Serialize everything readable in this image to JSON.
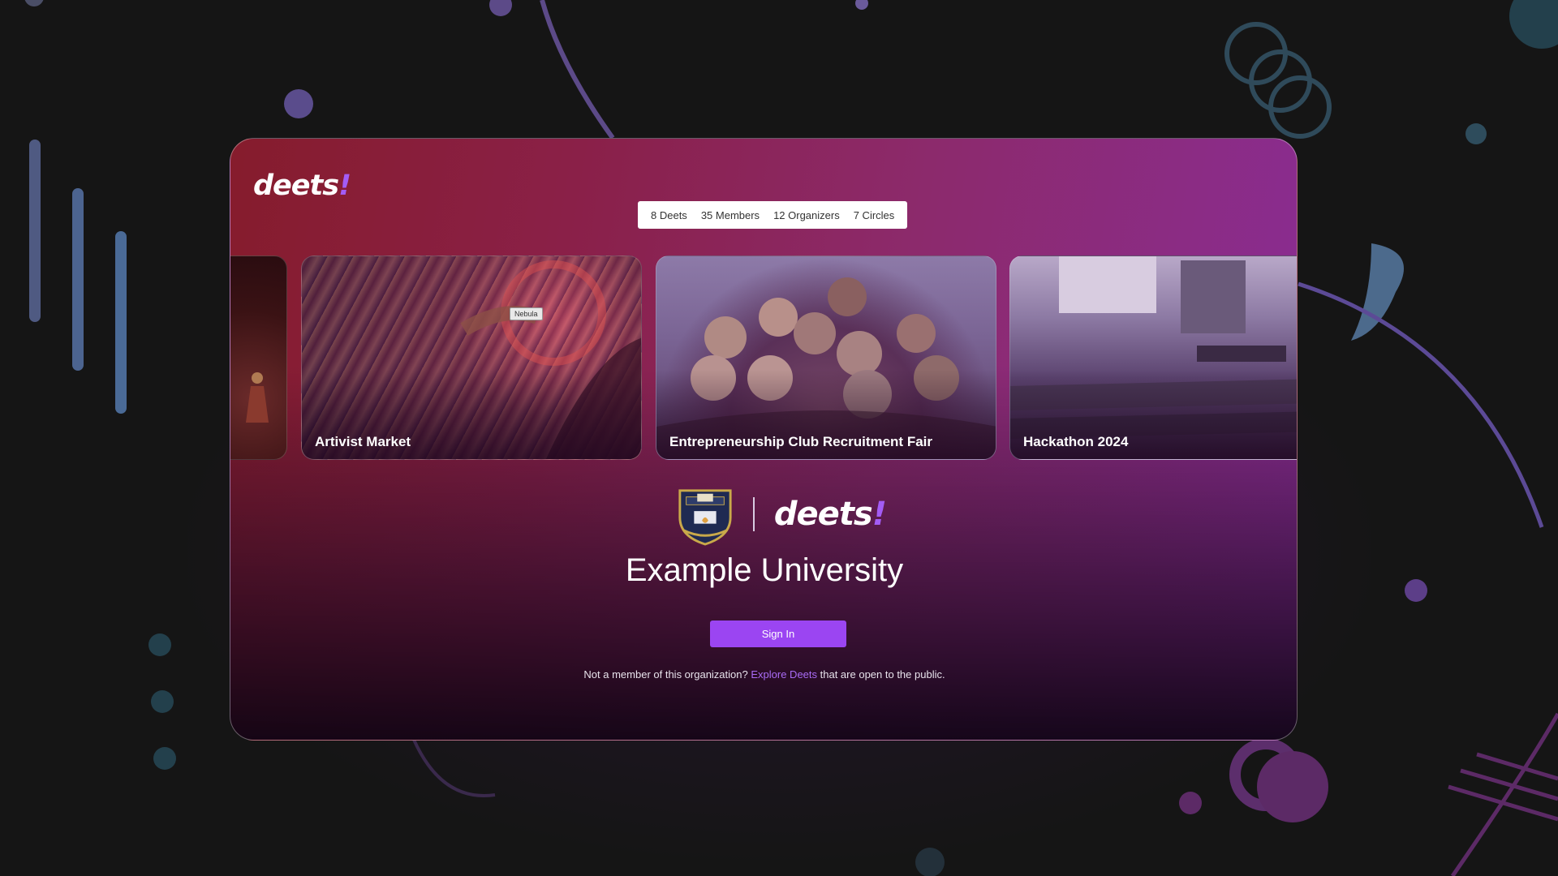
{
  "brand": {
    "logo_text": "deets",
    "logo_mark": "!",
    "accent_color": "#9b45f2"
  },
  "stats": {
    "deets": "8 Deets",
    "members": "35 Members",
    "organizers": "12 Organizers",
    "circles": "7 Circles"
  },
  "carousel": {
    "slides": [
      {
        "caption": "Artivist Market"
      },
      {
        "caption": "Entrepreneurship Club Recruitment Fair"
      },
      {
        "caption": "Hackathon 2024"
      }
    ],
    "tooltip": "Nebula"
  },
  "organization": {
    "name": "Example University",
    "crest_icon": "university-crest-icon"
  },
  "signin": {
    "label": "Sign In"
  },
  "footer_note": {
    "prefix": "Not a member of this organization?",
    "link": "Explore Deets",
    "suffix": "that are open to the public."
  }
}
